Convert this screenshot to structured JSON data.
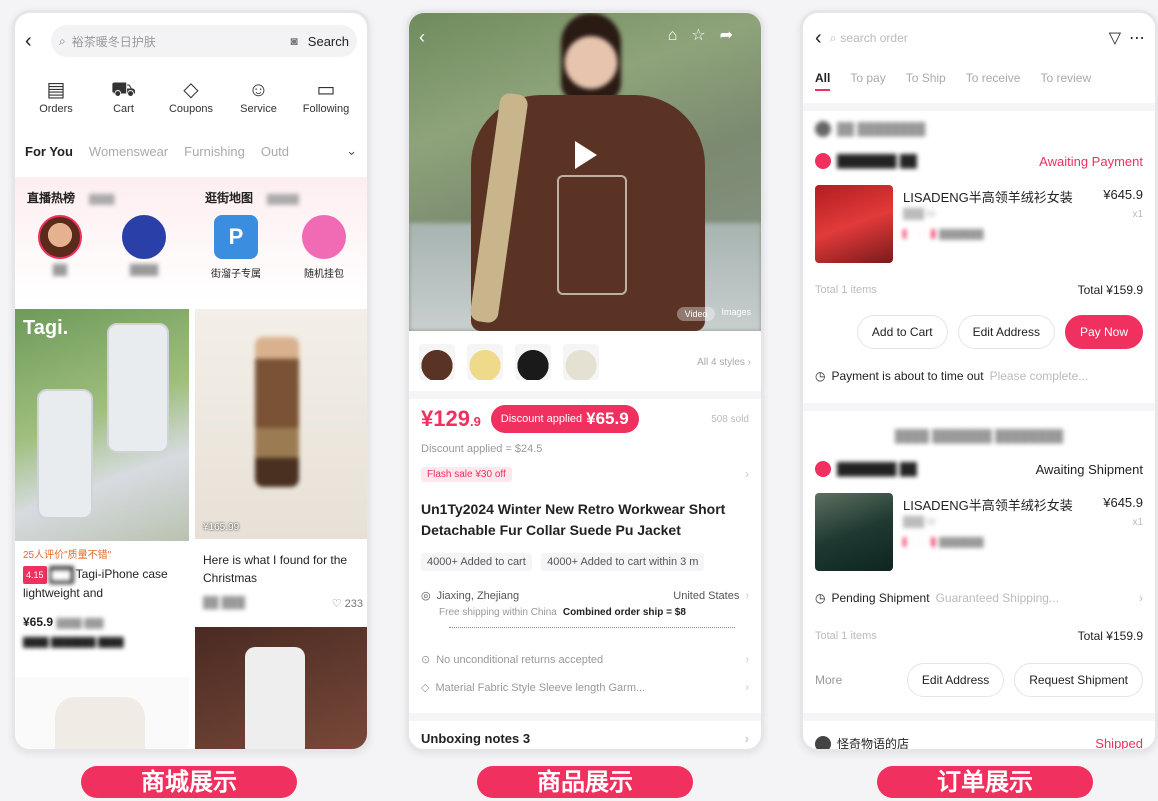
{
  "colors": {
    "accent": "#f0305e",
    "text": "#222222",
    "muted": "#999999"
  },
  "captions": {
    "mall": "商城展示",
    "product": "商品展示",
    "order": "订单展示"
  },
  "mall": {
    "back_icon": "back-arrow-icon",
    "search_placeholder": "裕茶暖冬日护肤",
    "search_button": "Search",
    "shortcuts": [
      {
        "label": "Orders",
        "icon": "clipboard-icon"
      },
      {
        "label": "Cart",
        "icon": "cart-icon"
      },
      {
        "label": "Coupons",
        "icon": "tag-icon"
      },
      {
        "label": "Service",
        "icon": "chat-icon"
      },
      {
        "label": "Following",
        "icon": "box-icon"
      }
    ],
    "tabs": [
      "For You",
      "Womenswear",
      "Furnishing",
      "Outd"
    ],
    "section_left": {
      "title": "直播热榜"
    },
    "section_right": {
      "title": "逛街地图"
    },
    "map_items": [
      "街溜子专属",
      "随机挂包"
    ],
    "products": [
      {
        "tag_line": "25人评价\"质量不错\"",
        "badge1": "4.15",
        "title": "Tagi-iPhone case lightweight and",
        "price": "¥65.9",
        "brand": "Tagi."
      },
      {
        "title": "Here is what I found for the Christmas",
        "likes": "233",
        "overlay_price": "¥165.99"
      }
    ]
  },
  "product": {
    "video_tabs": [
      "Video",
      "Images"
    ],
    "styles_link": "All 4 styles",
    "price": "¥129",
    "price_decimal": ".9",
    "discount_pill_label": "Discount applied",
    "discount_pill_value": "¥65.9",
    "sold": "508 sold",
    "discount_line": "Discount applied = $24.5",
    "flash_sale": "Flash sale ¥30 off",
    "title_line1": "Un1Ty2024 Winter New Retro Workwear Short",
    "title_line2": "Detachable Fur Collar Suede Pu Jacket",
    "chips": [
      "4000+ Added to cart",
      "4000+ Added to cart within 3 m"
    ],
    "ship_from": "Jiaxing, Zhejiang",
    "ship_to": "United States",
    "shipping_note": "Free shipping within China",
    "combined_ship": "Combined order ship = $8",
    "returns": "No unconditional returns accepted",
    "specs": "Material  Fabric  Style  Sleeve length  Garm...",
    "unboxing": "Unboxing notes 3"
  },
  "order": {
    "search_placeholder": "search order",
    "tabs": [
      "All",
      "To pay",
      "To Ship",
      "To receive",
      "To review"
    ],
    "orders": [
      {
        "status": "Awaiting Payment",
        "item_title": "LISADENG半高领羊绒衫女装",
        "item_price": "¥645.9",
        "qty": "x1",
        "total_items": "Total 1 items",
        "total": "Total ¥159.9",
        "buttons": [
          "Add to Cart",
          "Edit Address",
          "Pay Now"
        ],
        "note_bold": "Payment is about to time out",
        "note_dim": "Please complete..."
      },
      {
        "status": "Awaiting Shipment",
        "item_title": "LISADENG半高领羊绒衫女装",
        "item_price": "¥645.9",
        "qty": "x1",
        "note_bold": "Pending Shipment",
        "note_dim": "Guaranteed Shipping...",
        "total_items": "Total 1 items",
        "total": "Total ¥159.9",
        "more": "More",
        "buttons": [
          "Edit Address",
          "Request Shipment"
        ]
      }
    ],
    "third_store": "怪奇物语的店",
    "third_status": "Shipped"
  }
}
